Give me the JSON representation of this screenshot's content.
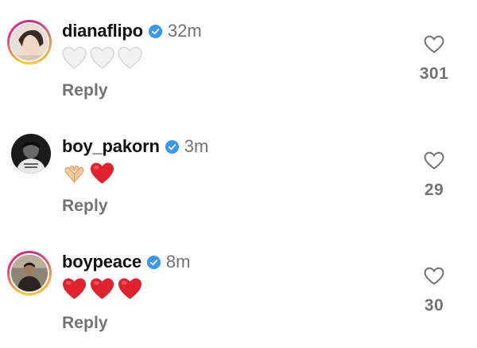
{
  "comments": [
    {
      "username": "dianaflipo",
      "time": "32m",
      "reply_label": "Reply",
      "likes": "301",
      "emojis": [
        "white-heart",
        "white-heart",
        "white-heart"
      ],
      "has_story_ring": true
    },
    {
      "username": "boy_pakorn",
      "time": "3m",
      "reply_label": "Reply",
      "likes": "29",
      "emojis": [
        "heart-hands",
        "red-heart"
      ],
      "has_story_ring": false
    },
    {
      "username": "boypeace",
      "time": "8m",
      "reply_label": "Reply",
      "likes": "30",
      "emojis": [
        "red-heart",
        "red-heart",
        "red-heart"
      ],
      "has_story_ring": true
    }
  ],
  "colors": {
    "verified_badge": "#3897f0",
    "secondary_text": "#737373",
    "red_heart": "#e0222f",
    "white_heart": "#e4e4e4"
  }
}
